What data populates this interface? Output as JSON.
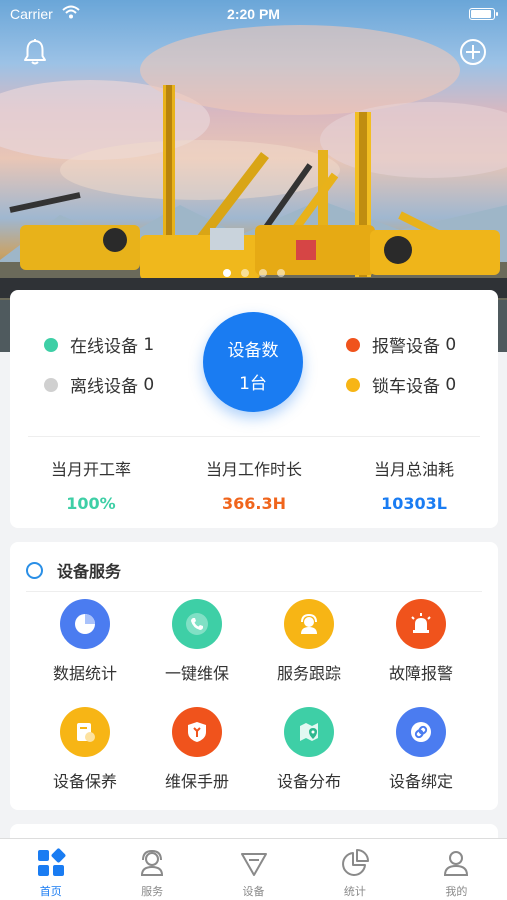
{
  "status_bar": {
    "carrier": "Carrier",
    "time": "2:20 PM"
  },
  "header": {
    "left_icon": "bell-icon",
    "right_icon": "plus-circle-icon"
  },
  "banner": {
    "slide_count": 4,
    "active_slide": 1
  },
  "stats": {
    "legend": [
      {
        "label": "在线设备",
        "value": "1",
        "color": "#3ecfa6"
      },
      {
        "label": "离线设备",
        "value": "0",
        "color": "#d0d0d0"
      },
      {
        "label": "报警设备",
        "value": "0",
        "color": "#f0531c"
      },
      {
        "label": "锁车设备",
        "value": "0",
        "color": "#f7b515"
      }
    ],
    "total": {
      "title": "设备数",
      "value": "1台",
      "color": "#1a7cf2"
    },
    "metrics": [
      {
        "label": "当月开工率",
        "value": "100%",
        "color": "#3ecfa6"
      },
      {
        "label": "当月工作时长",
        "value": "366.3H",
        "color": "#f0651c"
      },
      {
        "label": "当月总油耗",
        "value": "10303L",
        "color": "#1a7cf2"
      }
    ]
  },
  "services": {
    "title": "设备服务",
    "items": [
      {
        "label": "数据统计",
        "icon": "pie-chart-icon",
        "color": "#4b7cf0"
      },
      {
        "label": "一键维保",
        "icon": "phone-icon",
        "color": "#3ecfa6"
      },
      {
        "label": "服务跟踪",
        "icon": "headset-icon",
        "color": "#f7b515"
      },
      {
        "label": "故障报警",
        "icon": "alarm-light-icon",
        "color": "#f0531c"
      },
      {
        "label": "设备保养",
        "icon": "maintenance-doc-icon",
        "color": "#f7b515"
      },
      {
        "label": "维保手册",
        "icon": "shield-wrench-icon",
        "color": "#f0531c"
      },
      {
        "label": "设备分布",
        "icon": "map-pin-icon",
        "color": "#3ecfa6"
      },
      {
        "label": "设备绑定",
        "icon": "link-icon",
        "color": "#4b7cf0"
      }
    ]
  },
  "tabbar": {
    "items": [
      {
        "label": "首页",
        "icon": "home-grid-icon",
        "active": true
      },
      {
        "label": "服务",
        "icon": "service-person-icon",
        "active": false
      },
      {
        "label": "设备",
        "icon": "device-shield-icon",
        "active": false
      },
      {
        "label": "统计",
        "icon": "stats-pie-icon",
        "active": false
      },
      {
        "label": "我的",
        "icon": "user-icon",
        "active": false
      }
    ]
  }
}
